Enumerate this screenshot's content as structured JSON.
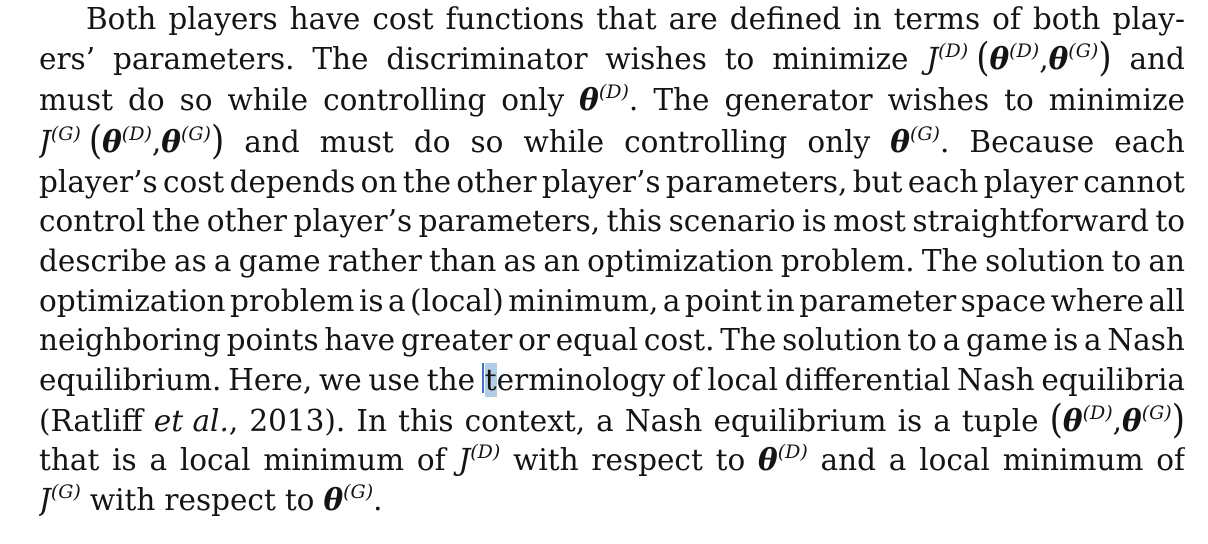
{
  "paragraph": {
    "lines": [
      {
        "indent": 47,
        "justify": true,
        "words": [
          "Both",
          "players",
          "have",
          "cost",
          "functions",
          "that",
          "are",
          "defined",
          "in",
          "terms",
          "of",
          "both",
          "play-"
        ]
      },
      {
        "justify": true,
        "words": [
          "ers’",
          "parameters.",
          "The",
          "discriminator",
          "wishes",
          "to",
          "minimize",
          "__M1__",
          "and"
        ]
      },
      {
        "justify": true,
        "words": [
          "must",
          "do",
          "so",
          "while",
          "controlling",
          "only",
          "__M2__",
          "The",
          "generator",
          "wishes",
          "to",
          "minimize"
        ]
      },
      {
        "justify": true,
        "words": [
          "__M3__",
          "and",
          "must",
          "do",
          "so",
          "while",
          "controlling",
          "only",
          "__M4__",
          "Because",
          "each"
        ]
      },
      {
        "justify": true,
        "words": [
          "player’s",
          "cost",
          "depends",
          "on",
          "the",
          "other",
          "player’s",
          "parameters,",
          "but",
          "each",
          "player",
          "cannot"
        ]
      },
      {
        "justify": true,
        "words": [
          "control",
          "the",
          "other",
          "player’s",
          "parameters,",
          "this",
          "scenario",
          "is",
          "most",
          "straightforward",
          "to"
        ]
      },
      {
        "justify": true,
        "words": [
          "describe",
          "as",
          "a",
          "game",
          "rather",
          "than",
          "as",
          "an",
          "optimization",
          "problem.",
          "The",
          "solution",
          "to",
          "an"
        ]
      },
      {
        "justify": true,
        "words": [
          "optimization",
          "problem",
          "is",
          "a",
          "(local)",
          "minimum,",
          "a",
          "point",
          "in",
          "parameter",
          "space",
          "where",
          "all"
        ]
      },
      {
        "justify": true,
        "words": [
          "neighboring",
          "points",
          "have",
          "greater",
          "or",
          "equal",
          "cost.",
          "The",
          "solution",
          "to",
          "a",
          "game",
          "is",
          "a",
          "Nash"
        ]
      },
      {
        "justify": true,
        "words": [
          "equilibrium.",
          "Here,",
          "we",
          "use",
          "the",
          "__CURSOR__",
          "of",
          "local",
          "differential",
          "Nash",
          "equilibria"
        ]
      },
      {
        "justify": true,
        "words": [
          "(Ratliff",
          "__ETAL__",
          "2013).",
          "In",
          "this",
          "context,",
          "a",
          "Nash",
          "equilibrium",
          "is",
          "a",
          "tuple",
          "__M5__"
        ]
      },
      {
        "justify": true,
        "words": [
          "that",
          "is",
          "a",
          "local",
          "minimum",
          "of",
          "__M6__",
          "with",
          "respect",
          "to",
          "__M7__",
          "and",
          "a",
          "local",
          "minimum",
          "of"
        ]
      },
      {
        "justify": false,
        "words": [
          "__M8__",
          "with",
          "respect",
          "to",
          "__M9__"
        ]
      }
    ],
    "tokens": {
      "highlighted_letter": "t",
      "after_highlight": "erminology",
      "etal_italic": "et al.",
      "etal_comma": ",",
      "J": "J",
      "theta": "θ",
      "D": "(D)",
      "G": "(G)",
      "comma": ",",
      "period": ".",
      "lparen": "(",
      "rparen": ")"
    }
  },
  "colors": {
    "text": "#141414",
    "highlight": "#b3cde6",
    "cursor": "#3f73c5",
    "background": "#ffffff"
  }
}
